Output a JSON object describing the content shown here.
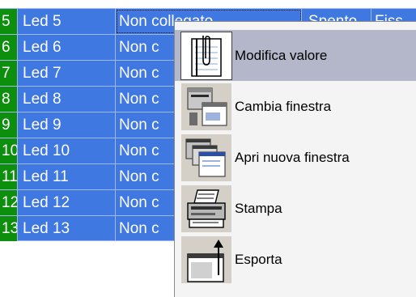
{
  "rows": [
    {
      "num": "5",
      "name": "Led 5",
      "state": "Non collegato",
      "value": "Spento",
      "fix": "Fiss"
    },
    {
      "num": "6",
      "name": "Led 6",
      "state": "Non c"
    },
    {
      "num": "7",
      "name": "Led 7",
      "state": "Non c"
    },
    {
      "num": "8",
      "name": "Led 8",
      "state": "Non c"
    },
    {
      "num": "9",
      "name": "Led 9",
      "state": "Non c"
    },
    {
      "num": "10",
      "name": "Led 10",
      "state": "Non c"
    },
    {
      "num": "11",
      "name": "Led 11",
      "state": "Non c"
    },
    {
      "num": "12",
      "name": "Led 12",
      "state": "Non c"
    },
    {
      "num": "13",
      "name": "Led 13",
      "state": "Non c"
    }
  ],
  "menu": {
    "items": [
      {
        "label": "Modifica valore",
        "icon": "notepad-paperclip-icon"
      },
      {
        "label": "Cambia finestra",
        "icon": "switch-window-icon"
      },
      {
        "label": "Apri nuova finestra",
        "icon": "new-windows-icon"
      },
      {
        "label": "Stampa",
        "icon": "printer-icon"
      },
      {
        "label": "Esporta",
        "icon": "export-icon"
      }
    ]
  },
  "colors": {
    "grid_bg": "#3f78e1",
    "row_number_bg": "#0d8f0d",
    "menu_bg": "#f4f4f4",
    "menu_highlight": "#b4b6ca"
  }
}
